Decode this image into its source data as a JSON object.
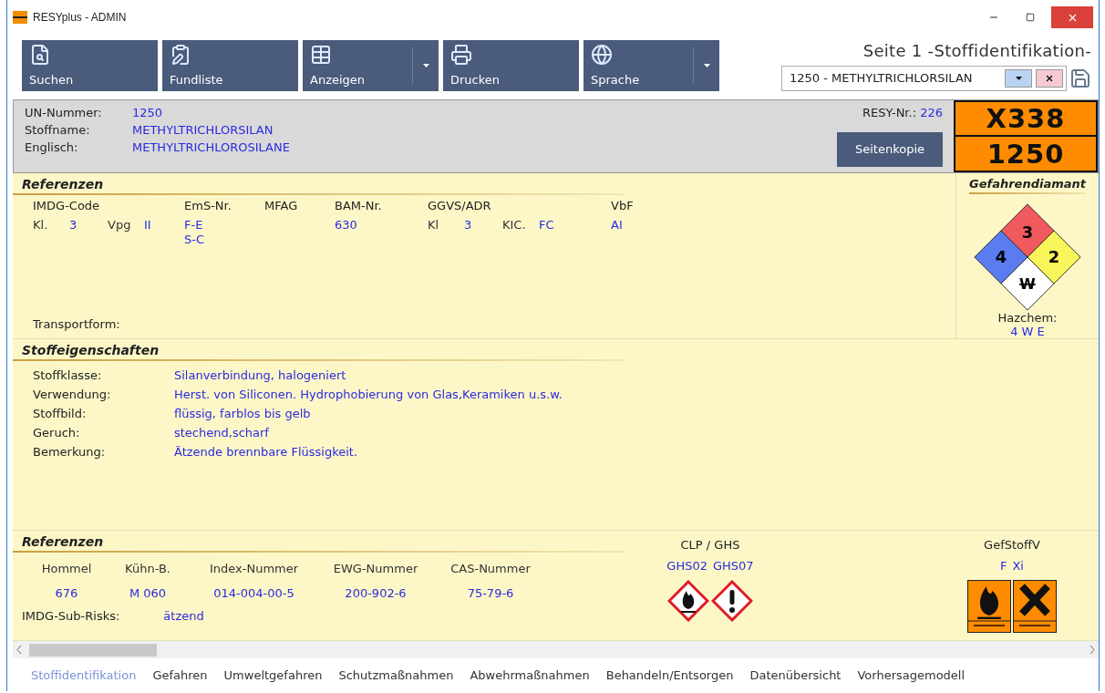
{
  "window": {
    "title": "RESYplus - ADMIN"
  },
  "toolbar": {
    "buttons": [
      {
        "label": "Suchen",
        "kind": "search",
        "split": false
      },
      {
        "label": "Fundliste",
        "kind": "list",
        "split": false
      },
      {
        "label": "Anzeigen",
        "kind": "table",
        "split": true
      },
      {
        "label": "Drucken",
        "kind": "print",
        "split": false
      },
      {
        "label": "Sprache",
        "kind": "globe",
        "split": true
      }
    ]
  },
  "page_title": "Seite 1 -Stoffidentifikation-",
  "substance_select": {
    "value": "1250 - METHYLTRICHLORSILAN"
  },
  "header": {
    "fields": [
      {
        "label": "UN-Nummer:",
        "value": "1250"
      },
      {
        "label": "Stoffname:",
        "value": "METHYLTRICHLORSILAN"
      },
      {
        "label": "Englisch:",
        "value": "METHYLTRICHLOROSILANE"
      }
    ],
    "resy_label": "RESY-Nr.:",
    "resy_value": "226",
    "copy_button": "Seitenkopie"
  },
  "orange_plate": {
    "hazard_number": "X338",
    "un_number": "1250"
  },
  "references": {
    "title": "Referenzen",
    "columns": [
      {
        "label": "IMDG-Code",
        "lines": [
          [
            {
              "kind": "label",
              "text": "Kl."
            },
            {
              "kind": "value",
              "text": "3"
            },
            {
              "kind": "label",
              "text": "Vpg"
            },
            {
              "kind": "value",
              "text": "II"
            }
          ]
        ]
      },
      {
        "label": "EmS-Nr.",
        "lines": [
          [
            {
              "kind": "value",
              "text": "F-E"
            }
          ],
          [
            {
              "kind": "value",
              "text": "S-C"
            }
          ]
        ]
      },
      {
        "label": "MFAG"
      },
      {
        "label": "BAM-Nr.",
        "lines": [
          [
            {
              "kind": "value",
              "text": "630"
            }
          ]
        ]
      },
      {
        "label": "GGVS/ADR",
        "lines": [
          [
            {
              "kind": "label",
              "text": "Kl"
            },
            {
              "kind": "value",
              "text": "3"
            },
            {
              "kind": "label",
              "text": "KIC."
            },
            {
              "kind": "value",
              "text": "FC"
            }
          ]
        ]
      },
      {
        "label": "VbF",
        "lines": [
          [
            {
              "kind": "value",
              "text": "AI"
            }
          ]
        ]
      }
    ],
    "transport_label": "Transportform:"
  },
  "hazard_diamond": {
    "title": "Gefahrendiamant",
    "health": "4",
    "flammability": "3",
    "reactivity": "2",
    "special": "W",
    "hazchem_label": "Hazchem:",
    "hazchem_value": "4 W E"
  },
  "properties": {
    "title": "Stoffeigenschaften",
    "rows": [
      {
        "label": "Stoffklasse:",
        "value": "Silanverbindung, halogeniert"
      },
      {
        "label": "Verwendung:",
        "value": "Herst. von Siliconen. Hydrophobierung von Glas,Keramiken u.s.w."
      },
      {
        "label": "Stoffbild:",
        "value": "flüssig, farblos bis gelb"
      },
      {
        "label": "Geruch:",
        "value": "stechend,scharf"
      },
      {
        "label": "Bemerkung:",
        "value": "Ätzende brennbare Flüssigkeit."
      }
    ]
  },
  "classification": {
    "title": "Referenzen",
    "columns": [
      {
        "label": "Hommel",
        "value": "676"
      },
      {
        "label": "Kühn-B.",
        "value": "M 060"
      },
      {
        "label": "Index-Nummer",
        "value": "014-004-00-5"
      },
      {
        "label": "EWG-Nummer",
        "value": "200-902-6"
      },
      {
        "label": "CAS-Nummer",
        "value": "75-79-6"
      }
    ],
    "sub_risks_label": "IMDG-Sub-Risks:",
    "sub_risks_value": "ätzend",
    "clp_title": "CLP / GHS",
    "ghs": [
      {
        "code": "GHS02",
        "kind": "flame"
      },
      {
        "code": "GHS07",
        "kind": "exclamation"
      }
    ],
    "gefstoff_title": "GefStoffV",
    "gefstoff": [
      {
        "code": "F",
        "kind": "flame"
      },
      {
        "code": "Xi",
        "kind": "cross"
      }
    ]
  },
  "tabs": [
    {
      "label": "Stoffidentifikation",
      "selected": true
    },
    {
      "label": "Gefahren",
      "selected": false
    },
    {
      "label": "Umweltgefahren",
      "selected": false
    },
    {
      "label": "Schutzmaßnahmen",
      "selected": false
    },
    {
      "label": "Abwehrmaßnahmen",
      "selected": false
    },
    {
      "label": "Behandeln/Entsorgen",
      "selected": false
    },
    {
      "label": "Datenübersicht",
      "selected": false
    },
    {
      "label": "Vorhersagemodell",
      "selected": false
    }
  ]
}
